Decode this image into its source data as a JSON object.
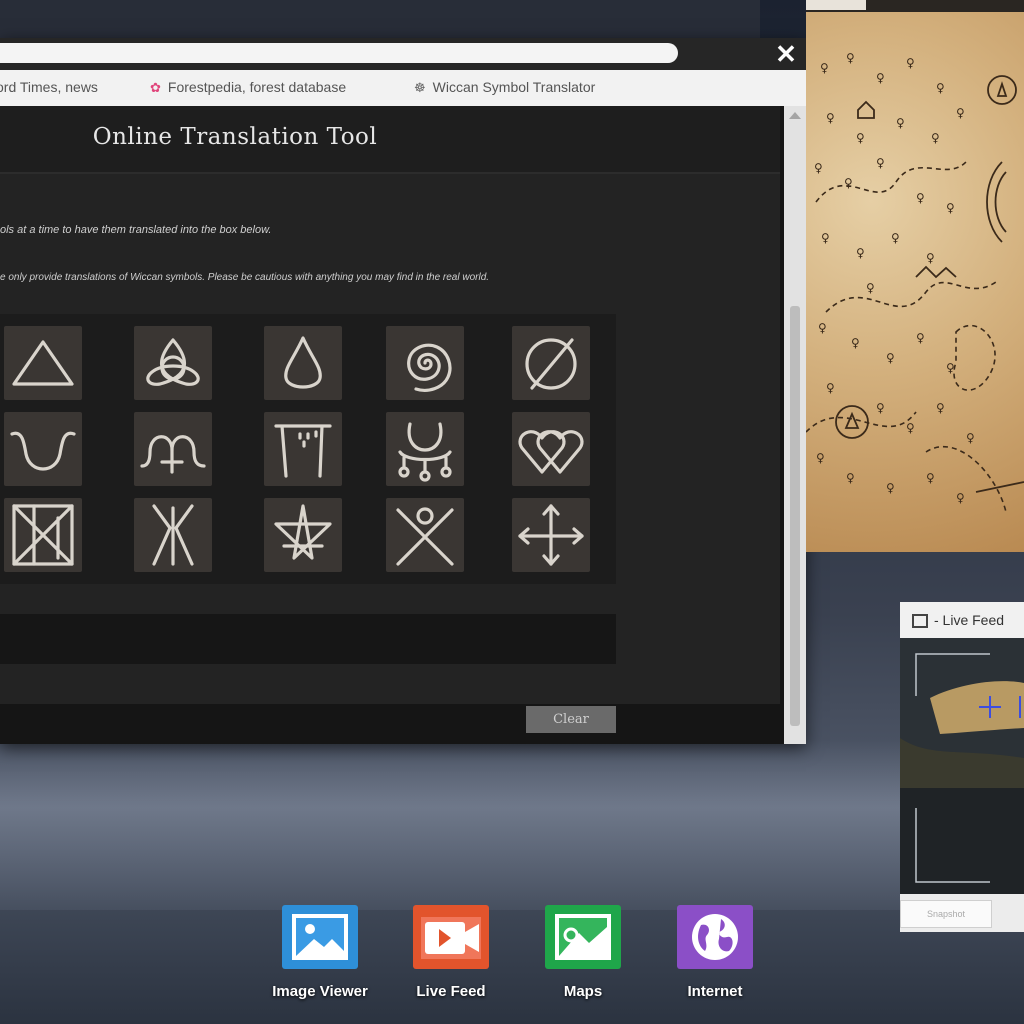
{
  "bookmarks": [
    {
      "icon": "newspaper-icon",
      "label": "ord Times, news"
    },
    {
      "icon": "leaf-icon",
      "label": "Forestpedia, forest database"
    },
    {
      "icon": "pentacle-icon",
      "label": "Wiccan Symbol Translator"
    }
  ],
  "tool": {
    "title": "Online Translation Tool",
    "instruction_1": "ols at a time to have them translated into the box below.",
    "instruction_2": "e only provide translations of Wiccan symbols. Please be cautious with anything you may find in the real world.",
    "clear_label": "Clear",
    "symbols": [
      "triangle",
      "triquetra",
      "water-drop",
      "spiral",
      "slashed-circle",
      "horned-curve",
      "double-arch",
      "gate",
      "crescent-charms",
      "double-heart",
      "boxed-x",
      "rune-star",
      "septagram",
      "figure-x",
      "arrow-cross"
    ]
  },
  "live_feed": {
    "title": "- Live Feed",
    "button_label": "Snapshot"
  },
  "dock": [
    {
      "label": "Image Viewer",
      "color": "#2e8fd8"
    },
    {
      "label": "Live Feed",
      "color": "#e2542c"
    },
    {
      "label": "Maps",
      "color": "#1fa64a"
    },
    {
      "label": "Internet",
      "color": "#8b4fc7"
    }
  ]
}
